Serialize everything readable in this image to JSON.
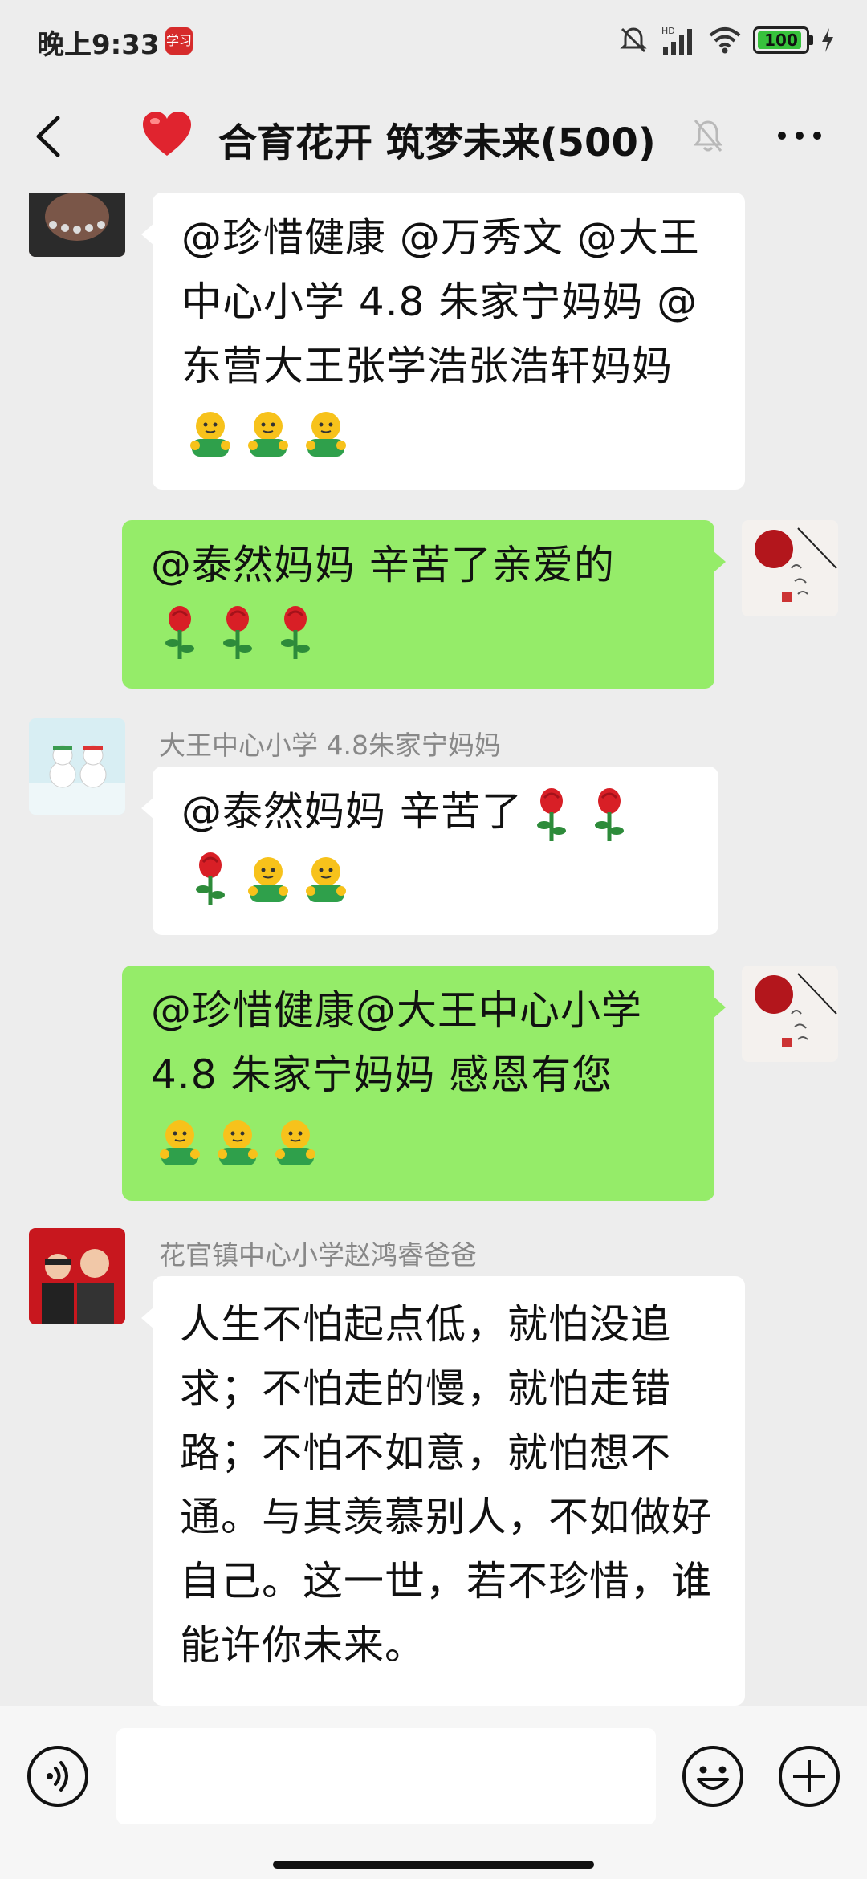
{
  "status_bar": {
    "time": "晚上9:33",
    "app_badge": "学习",
    "battery": "100",
    "signal": "HD"
  },
  "header": {
    "title": "合育花开 筑梦未来(500)"
  },
  "messages": [
    {
      "side": "left",
      "text": "@珍惜健康 @万秀文 @大王中心小学 4.8 朱家宁妈妈 @东营大王张学浩张浩轩妈妈"
    },
    {
      "side": "right",
      "text": "@泰然妈妈  辛苦了亲爱的"
    },
    {
      "side": "left",
      "sender": "大王中心小学 4.8朱家宁妈妈",
      "text": "@泰然妈妈  辛苦了"
    },
    {
      "side": "right",
      "text": "@珍惜健康@大王中心小学 4.8 朱家宁妈妈  感恩有您"
    },
    {
      "side": "left",
      "sender": "花官镇中心小学赵鸿睿爸爸",
      "text": "人生不怕起点低，就怕没追求；不怕走的慢，就怕走错路；不怕不如意，就怕想不通。与其羡慕别人，不如做好自己。这一世，若不珍惜，谁能许你未来。"
    }
  ],
  "emojis": {
    "hug": "hugging-emoji",
    "rose": "rose-emoji"
  },
  "colors": {
    "bubble_right": "#95ec69",
    "bubble_left": "#ffffff",
    "background": "#ededed"
  }
}
